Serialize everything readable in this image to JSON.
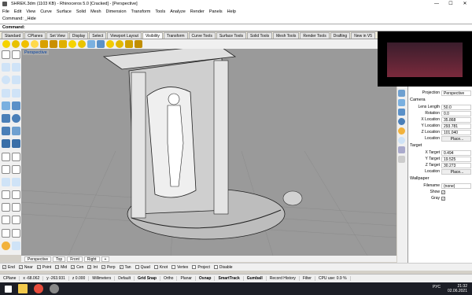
{
  "window": {
    "title": "SHREK.3dm (1103 KB) - Rhinoceros 5.0 [Cracked] - [Perspective]",
    "min": "—",
    "max": "☐",
    "close": "✕"
  },
  "menu": [
    "File",
    "Edit",
    "View",
    "Curve",
    "Surface",
    "Solid",
    "Mesh",
    "Dimension",
    "Transform",
    "Tools",
    "Analyze",
    "Render",
    "Panels",
    "Help"
  ],
  "command": {
    "history": "Command: _Hide",
    "prompt": "Command:"
  },
  "toolbar_tabs": [
    "Standard",
    "CPlanes",
    "Set View",
    "Display",
    "Select",
    "Viewport Layout",
    "Visibility",
    "Transform",
    "Curve Tools",
    "Surface Tools",
    "Solid Tools",
    "Mesh Tools",
    "Render Tools",
    "Drafting",
    "New in V5"
  ],
  "active_tab": "Visibility",
  "viewport": {
    "label": "Perspective"
  },
  "properties": {
    "projection_label": "Projection",
    "projection_value": "Perspective",
    "camera_title": "Camera",
    "lens_label": "Lens Length",
    "lens_value": "50.0",
    "rotation_label": "Rotation",
    "rotation_value": "0.0",
    "xloc_label": "X Location",
    "xloc_value": "35.868",
    "yloc_label": "Y Location",
    "yloc_value": "293.781",
    "zloc_label": "Z Location",
    "zloc_value": "101.040",
    "location_label": "Location",
    "place_btn": "Place...",
    "target_title": "Target",
    "xt_label": "X Target",
    "xt_value": "0.494",
    "yt_label": "Y Target",
    "yt_value": "19.525",
    "zt_label": "Z Target",
    "zt_value": "30.273",
    "tloc_label": "Location",
    "tplace_btn": "Place...",
    "wallpaper_title": "Wallpaper",
    "filename_label": "Filename",
    "filename_value": "(none)",
    "show_label": "Show",
    "gray_label": "Gray"
  },
  "vp_tabs": [
    "Perspective",
    "Top",
    "Front",
    "Right",
    "+"
  ],
  "osnaps": [
    {
      "label": "End",
      "checked": true
    },
    {
      "label": "Near",
      "checked": true
    },
    {
      "label": "Point",
      "checked": true
    },
    {
      "label": "Mid",
      "checked": true
    },
    {
      "label": "Cen",
      "checked": true
    },
    {
      "label": "Int",
      "checked": true
    },
    {
      "label": "Perp",
      "checked": true
    },
    {
      "label": "Tan",
      "checked": true
    },
    {
      "label": "Quad",
      "checked": false
    },
    {
      "label": "Knot",
      "checked": false
    },
    {
      "label": "Vertex",
      "checked": false
    },
    {
      "label": "Project",
      "checked": false
    },
    {
      "label": "Disable",
      "checked": false
    }
  ],
  "status": {
    "cplane": "CPlane",
    "x": "x -68.062",
    "y": "y -263.931",
    "z": "z 0.000",
    "units": "Millimeters",
    "layer": "Default",
    "grid_snap": "Grid Snap",
    "ortho": "Ortho",
    "planar": "Planar",
    "osnap": "Osnap",
    "smarttrack": "SmartTrack",
    "gumball": "Gumball",
    "record": "Record History",
    "filter": "Filter",
    "cpu": "CPU use: 0.9 %"
  },
  "clock": {
    "time": "21:32",
    "date": "02.06.2021",
    "lang": "РУС"
  }
}
